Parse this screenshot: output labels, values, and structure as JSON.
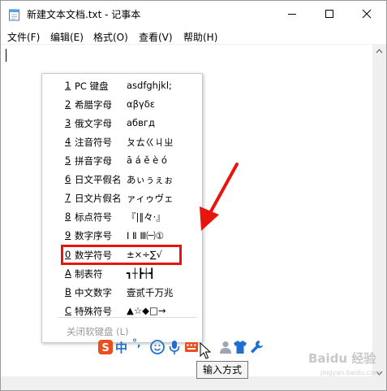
{
  "window": {
    "title": "新建文本文档.txt - 记事本"
  },
  "menu": [
    "文件(F)",
    "编辑(E)",
    "格式(O)",
    "查看(V)",
    "帮助(H)"
  ],
  "soft_keyboard_menu": {
    "items": [
      {
        "key": "1",
        "label": "PC 键盘",
        "sample": "asdfghjkl;"
      },
      {
        "key": "2",
        "label": "希腊字母",
        "sample": "αβγδε"
      },
      {
        "key": "3",
        "label": "俄文字母",
        "sample": "абвгд"
      },
      {
        "key": "4",
        "label": "注音符号",
        "sample": "ㄆㄊㄍㄐㄓ"
      },
      {
        "key": "5",
        "label": "拼音字母",
        "sample": "ā á ě è ó"
      },
      {
        "key": "6",
        "label": "日文平假名",
        "sample": "あぃぅぇぉ"
      },
      {
        "key": "7",
        "label": "日文片假名",
        "sample": "ァィゥヴェ"
      },
      {
        "key": "8",
        "label": "标点符号",
        "sample": "『|‖々·』"
      },
      {
        "key": "9",
        "label": "数字序号",
        "sample": "Ⅰ Ⅱ Ⅲ㈠①"
      },
      {
        "key": "0",
        "label": "数学符号",
        "sample": "±×÷∑√"
      },
      {
        "key": "A",
        "label": "制表符",
        "sample": "┓┼┣┼┫"
      },
      {
        "key": "B",
        "label": "中文数字",
        "sample": "壹贰千万兆"
      },
      {
        "key": "C",
        "label": "特殊符号",
        "sample": "▲☆◆□→"
      }
    ],
    "close_label": "关闭软键盘 (L)"
  },
  "ime_toolbar": {
    "mode_label": "中",
    "punct_label": "°,",
    "icons": [
      "sogou-logo-icon",
      "emoji-icon",
      "microphone-icon",
      "keyboard-icon",
      "user-icon",
      "skin-icon",
      "tools-icon"
    ]
  },
  "tooltip": "输入方式",
  "watermark": {
    "text": "Baidu 经验",
    "sub": "jingyan.baidu.com"
  },
  "colors": {
    "highlight": "#e8150f",
    "arrow": "#e8150f",
    "ime_blue": "#1e6fd0",
    "sogou_red": "#e94e1b"
  }
}
